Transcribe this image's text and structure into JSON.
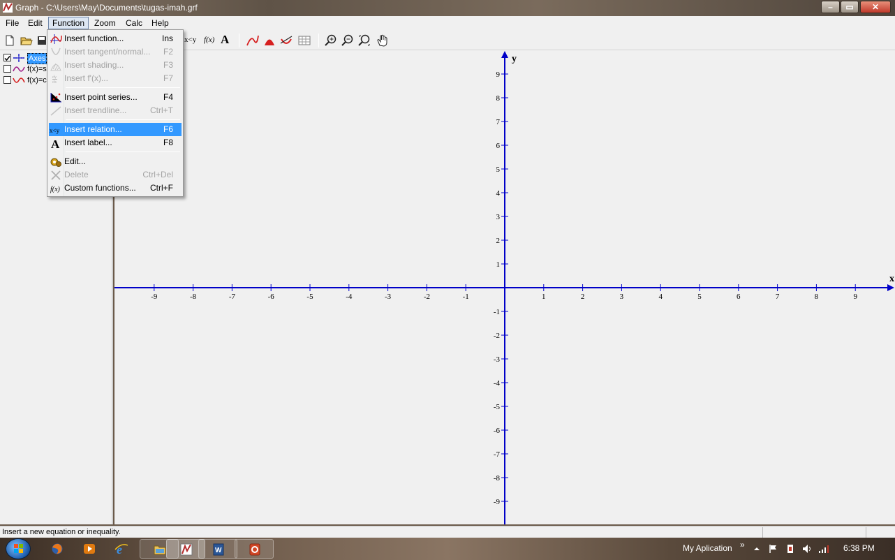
{
  "window": {
    "title": "Graph - C:\\Users\\May\\Documents\\tugas-imah.grf",
    "minimize_label": "–",
    "maximize_label": "▭",
    "close_label": "✕"
  },
  "menubar": {
    "file": "File",
    "edit": "Edit",
    "function": "Function",
    "zoom": "Zoom",
    "calc": "Calc",
    "help": "Help"
  },
  "function_menu": {
    "items": [
      {
        "label": "Insert function...",
        "key": "Ins",
        "enabled": true
      },
      {
        "label": "Insert tangent/normal...",
        "key": "F2",
        "enabled": false
      },
      {
        "label": "Insert shading...",
        "key": "F3",
        "enabled": false
      },
      {
        "label": "Insert f'(x)...",
        "key": "F7",
        "enabled": false
      },
      {
        "label": "Insert point series...",
        "key": "F4",
        "enabled": true
      },
      {
        "label": "Insert trendline...",
        "key": "Ctrl+T",
        "enabled": false
      },
      {
        "label": "Insert relation...",
        "key": "F6",
        "enabled": true,
        "highlighted": true
      },
      {
        "label": "Insert label...",
        "key": "F8",
        "enabled": true
      },
      {
        "label": "Edit...",
        "key": "",
        "enabled": true
      },
      {
        "label": "Delete",
        "key": "Ctrl+Del",
        "enabled": false
      },
      {
        "label": "Custom functions...",
        "key": "Ctrl+F",
        "enabled": true
      }
    ]
  },
  "toolbar": {
    "relation_label": "x<y",
    "fx_label": "f(x)",
    "label_label": "A"
  },
  "function_list": {
    "items": [
      {
        "label": "Axes",
        "checked": true,
        "selected": true
      },
      {
        "label": "f(x)=si",
        "checked": false,
        "selected": false
      },
      {
        "label": "f(x)=co",
        "checked": false,
        "selected": false
      }
    ]
  },
  "graph": {
    "x_axis_name": "x",
    "y_axis_name": "y",
    "axis_color": "#0000c8",
    "x_ticks": [
      -9,
      -8,
      -7,
      -6,
      -5,
      -4,
      -3,
      -2,
      -1,
      1,
      2,
      3,
      4,
      5,
      6,
      7,
      8,
      9
    ],
    "y_ticks": [
      9,
      8,
      7,
      6,
      5,
      4,
      3,
      2,
      1,
      -1,
      -2,
      -3,
      -4,
      -5,
      -6,
      -7,
      -8,
      -9
    ],
    "xlim": [
      -10,
      10
    ],
    "ylim": [
      -10,
      10
    ]
  },
  "statusbar": {
    "text": "Insert a new equation or inequality."
  },
  "taskbar": {
    "tray_label": "My Aplication",
    "chevron": "»",
    "clock": "6:38 PM"
  }
}
